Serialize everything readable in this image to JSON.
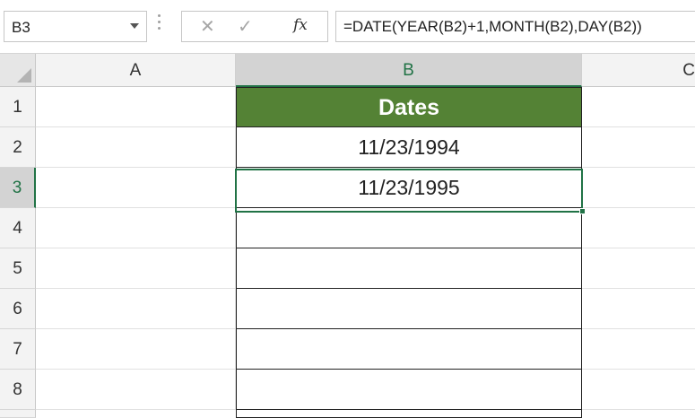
{
  "formula_bar": {
    "name_box": "B3",
    "cancel_glyph": "✕",
    "enter_glyph": "✓",
    "fx_label": "fx",
    "formula": "=DATE(YEAR(B2)+1,MONTH(B2),DAY(B2))"
  },
  "columns": [
    {
      "label": "A"
    },
    {
      "label": "B"
    },
    {
      "label": "C"
    }
  ],
  "rows": [
    {
      "num": "1",
      "a": "",
      "b": "Dates",
      "c": ""
    },
    {
      "num": "2",
      "a": "",
      "b": "11/23/1994",
      "c": ""
    },
    {
      "num": "3",
      "a": "",
      "b": "11/23/1995",
      "c": ""
    },
    {
      "num": "4",
      "a": "",
      "b": "",
      "c": ""
    },
    {
      "num": "5",
      "a": "",
      "b": "",
      "c": ""
    },
    {
      "num": "6",
      "a": "",
      "b": "",
      "c": ""
    },
    {
      "num": "7",
      "a": "",
      "b": "",
      "c": ""
    },
    {
      "num": "8",
      "a": "",
      "b": "",
      "c": ""
    }
  ],
  "selection": {
    "cell": "B3"
  },
  "colors": {
    "header_fill": "#548235",
    "accent": "#217346"
  }
}
